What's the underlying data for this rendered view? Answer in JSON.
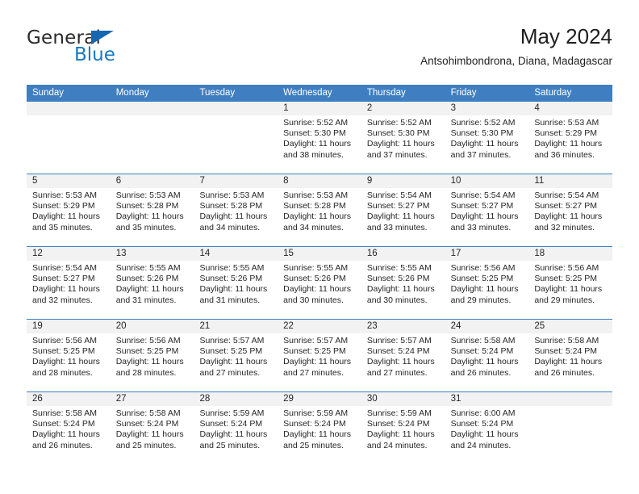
{
  "brand": {
    "name_top": "General",
    "name_bottom": "Blue",
    "triangle_color": "#1567b2",
    "blue_text_color": "#1778c2"
  },
  "header": {
    "title": "May 2024",
    "subtitle": "Antsohimbondrona, Diana, Madagascar"
  },
  "theme": {
    "header_blue": "#3f7fc1",
    "daynum_band": "#f2f2f2",
    "text": "#262626"
  },
  "weekdays": [
    "Sunday",
    "Monday",
    "Tuesday",
    "Wednesday",
    "Thursday",
    "Friday",
    "Saturday"
  ],
  "labels": {
    "sunrise_prefix": "Sunrise:",
    "sunset_prefix": "Sunset:",
    "daylight_prefix": "Daylight:"
  },
  "weeks": [
    [
      {
        "day": "",
        "empty": true
      },
      {
        "day": "",
        "empty": true
      },
      {
        "day": "",
        "empty": true
      },
      {
        "day": "1",
        "sunrise": "Sunrise: 5:52 AM",
        "sunset": "Sunset: 5:30 PM",
        "daylight_1": "Daylight: 11 hours",
        "daylight_2": "and 38 minutes."
      },
      {
        "day": "2",
        "sunrise": "Sunrise: 5:52 AM",
        "sunset": "Sunset: 5:30 PM",
        "daylight_1": "Daylight: 11 hours",
        "daylight_2": "and 37 minutes."
      },
      {
        "day": "3",
        "sunrise": "Sunrise: 5:52 AM",
        "sunset": "Sunset: 5:30 PM",
        "daylight_1": "Daylight: 11 hours",
        "daylight_2": "and 37 minutes."
      },
      {
        "day": "4",
        "sunrise": "Sunrise: 5:53 AM",
        "sunset": "Sunset: 5:29 PM",
        "daylight_1": "Daylight: 11 hours",
        "daylight_2": "and 36 minutes."
      }
    ],
    [
      {
        "day": "5",
        "sunrise": "Sunrise: 5:53 AM",
        "sunset": "Sunset: 5:29 PM",
        "daylight_1": "Daylight: 11 hours",
        "daylight_2": "and 35 minutes."
      },
      {
        "day": "6",
        "sunrise": "Sunrise: 5:53 AM",
        "sunset": "Sunset: 5:28 PM",
        "daylight_1": "Daylight: 11 hours",
        "daylight_2": "and 35 minutes."
      },
      {
        "day": "7",
        "sunrise": "Sunrise: 5:53 AM",
        "sunset": "Sunset: 5:28 PM",
        "daylight_1": "Daylight: 11 hours",
        "daylight_2": "and 34 minutes."
      },
      {
        "day": "8",
        "sunrise": "Sunrise: 5:53 AM",
        "sunset": "Sunset: 5:28 PM",
        "daylight_1": "Daylight: 11 hours",
        "daylight_2": "and 34 minutes."
      },
      {
        "day": "9",
        "sunrise": "Sunrise: 5:54 AM",
        "sunset": "Sunset: 5:27 PM",
        "daylight_1": "Daylight: 11 hours",
        "daylight_2": "and 33 minutes."
      },
      {
        "day": "10",
        "sunrise": "Sunrise: 5:54 AM",
        "sunset": "Sunset: 5:27 PM",
        "daylight_1": "Daylight: 11 hours",
        "daylight_2": "and 33 minutes."
      },
      {
        "day": "11",
        "sunrise": "Sunrise: 5:54 AM",
        "sunset": "Sunset: 5:27 PM",
        "daylight_1": "Daylight: 11 hours",
        "daylight_2": "and 32 minutes."
      }
    ],
    [
      {
        "day": "12",
        "sunrise": "Sunrise: 5:54 AM",
        "sunset": "Sunset: 5:27 PM",
        "daylight_1": "Daylight: 11 hours",
        "daylight_2": "and 32 minutes."
      },
      {
        "day": "13",
        "sunrise": "Sunrise: 5:55 AM",
        "sunset": "Sunset: 5:26 PM",
        "daylight_1": "Daylight: 11 hours",
        "daylight_2": "and 31 minutes."
      },
      {
        "day": "14",
        "sunrise": "Sunrise: 5:55 AM",
        "sunset": "Sunset: 5:26 PM",
        "daylight_1": "Daylight: 11 hours",
        "daylight_2": "and 31 minutes."
      },
      {
        "day": "15",
        "sunrise": "Sunrise: 5:55 AM",
        "sunset": "Sunset: 5:26 PM",
        "daylight_1": "Daylight: 11 hours",
        "daylight_2": "and 30 minutes."
      },
      {
        "day": "16",
        "sunrise": "Sunrise: 5:55 AM",
        "sunset": "Sunset: 5:26 PM",
        "daylight_1": "Daylight: 11 hours",
        "daylight_2": "and 30 minutes."
      },
      {
        "day": "17",
        "sunrise": "Sunrise: 5:56 AM",
        "sunset": "Sunset: 5:25 PM",
        "daylight_1": "Daylight: 11 hours",
        "daylight_2": "and 29 minutes."
      },
      {
        "day": "18",
        "sunrise": "Sunrise: 5:56 AM",
        "sunset": "Sunset: 5:25 PM",
        "daylight_1": "Daylight: 11 hours",
        "daylight_2": "and 29 minutes."
      }
    ],
    [
      {
        "day": "19",
        "sunrise": "Sunrise: 5:56 AM",
        "sunset": "Sunset: 5:25 PM",
        "daylight_1": "Daylight: 11 hours",
        "daylight_2": "and 28 minutes."
      },
      {
        "day": "20",
        "sunrise": "Sunrise: 5:56 AM",
        "sunset": "Sunset: 5:25 PM",
        "daylight_1": "Daylight: 11 hours",
        "daylight_2": "and 28 minutes."
      },
      {
        "day": "21",
        "sunrise": "Sunrise: 5:57 AM",
        "sunset": "Sunset: 5:25 PM",
        "daylight_1": "Daylight: 11 hours",
        "daylight_2": "and 27 minutes."
      },
      {
        "day": "22",
        "sunrise": "Sunrise: 5:57 AM",
        "sunset": "Sunset: 5:25 PM",
        "daylight_1": "Daylight: 11 hours",
        "daylight_2": "and 27 minutes."
      },
      {
        "day": "23",
        "sunrise": "Sunrise: 5:57 AM",
        "sunset": "Sunset: 5:24 PM",
        "daylight_1": "Daylight: 11 hours",
        "daylight_2": "and 27 minutes."
      },
      {
        "day": "24",
        "sunrise": "Sunrise: 5:58 AM",
        "sunset": "Sunset: 5:24 PM",
        "daylight_1": "Daylight: 11 hours",
        "daylight_2": "and 26 minutes."
      },
      {
        "day": "25",
        "sunrise": "Sunrise: 5:58 AM",
        "sunset": "Sunset: 5:24 PM",
        "daylight_1": "Daylight: 11 hours",
        "daylight_2": "and 26 minutes."
      }
    ],
    [
      {
        "day": "26",
        "sunrise": "Sunrise: 5:58 AM",
        "sunset": "Sunset: 5:24 PM",
        "daylight_1": "Daylight: 11 hours",
        "daylight_2": "and 26 minutes."
      },
      {
        "day": "27",
        "sunrise": "Sunrise: 5:58 AM",
        "sunset": "Sunset: 5:24 PM",
        "daylight_1": "Daylight: 11 hours",
        "daylight_2": "and 25 minutes."
      },
      {
        "day": "28",
        "sunrise": "Sunrise: 5:59 AM",
        "sunset": "Sunset: 5:24 PM",
        "daylight_1": "Daylight: 11 hours",
        "daylight_2": "and 25 minutes."
      },
      {
        "day": "29",
        "sunrise": "Sunrise: 5:59 AM",
        "sunset": "Sunset: 5:24 PM",
        "daylight_1": "Daylight: 11 hours",
        "daylight_2": "and 25 minutes."
      },
      {
        "day": "30",
        "sunrise": "Sunrise: 5:59 AM",
        "sunset": "Sunset: 5:24 PM",
        "daylight_1": "Daylight: 11 hours",
        "daylight_2": "and 24 minutes."
      },
      {
        "day": "31",
        "sunrise": "Sunrise: 6:00 AM",
        "sunset": "Sunset: 5:24 PM",
        "daylight_1": "Daylight: 11 hours",
        "daylight_2": "and 24 minutes."
      },
      {
        "day": "",
        "empty": true
      }
    ]
  ]
}
